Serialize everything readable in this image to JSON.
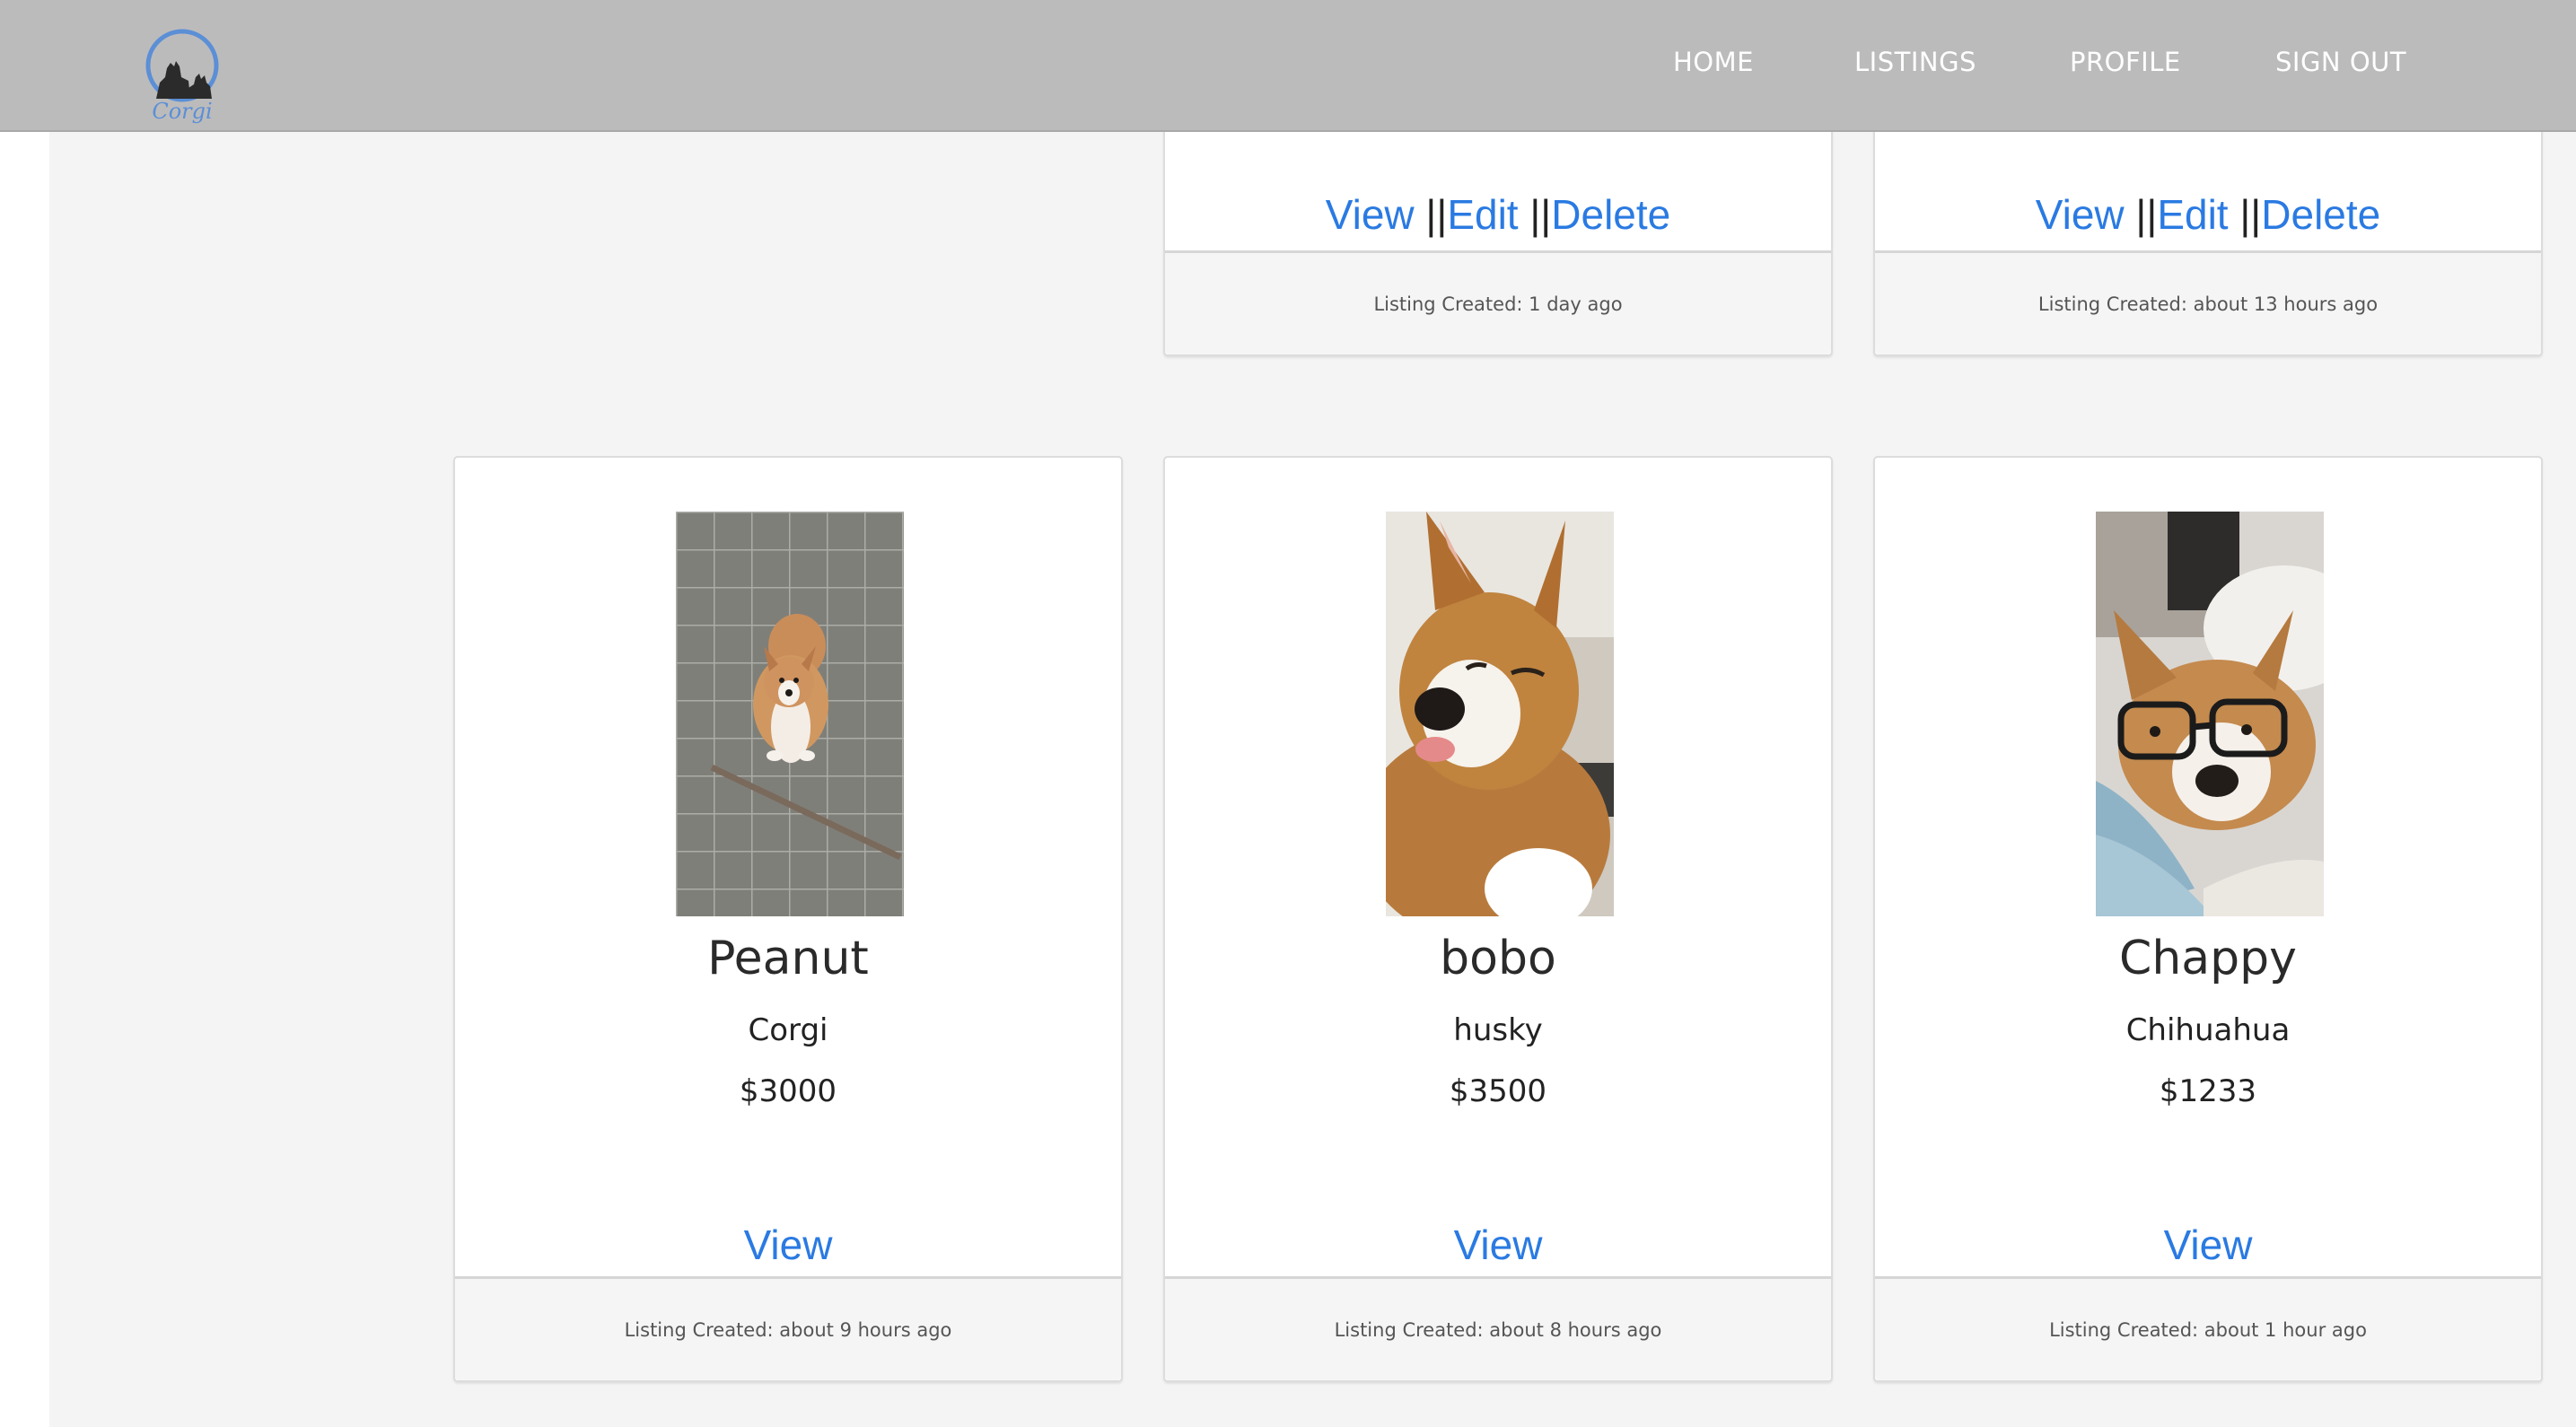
{
  "nav": {
    "logo_text": "Corgi",
    "links": [
      "HOME",
      "LISTINGS",
      "PROFILE",
      "SIGN OUT"
    ]
  },
  "colors": {
    "navbar": "#bcbbbc",
    "link": "#2a7ae2",
    "panel": "#f4f4f4"
  },
  "top_cards": [
    {
      "actions": [
        "View",
        "Edit",
        "Delete"
      ],
      "separator": "||",
      "created": "Listing Created: 1 day ago"
    },
    {
      "actions": [
        "View",
        "Edit",
        "Delete"
      ],
      "separator": "||",
      "created": "Listing Created: about 13 hours ago"
    }
  ],
  "listings": [
    {
      "name": "Peanut",
      "breed": "Corgi",
      "price": "$3000",
      "action": "View",
      "created": "Listing Created: about 9 hours ago",
      "photo": "corgi-sitting-on-tiles"
    },
    {
      "name": "bobo",
      "breed": "husky",
      "price": "$3500",
      "action": "View",
      "created": "Listing Created: about 8 hours ago",
      "photo": "corgi-closeup-tongue-out"
    },
    {
      "name": "Chappy",
      "breed": "Chihuahua",
      "price": "$1233",
      "action": "View",
      "created": "Listing Created: about 1 hour ago",
      "photo": "corgi-wearing-glasses"
    }
  ]
}
